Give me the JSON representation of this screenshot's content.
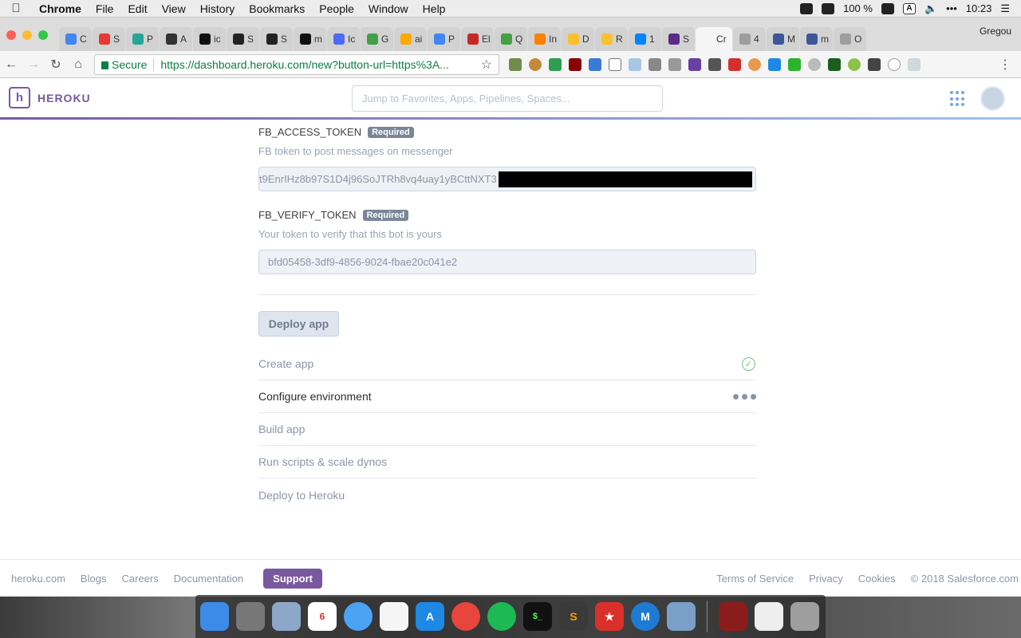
{
  "menubar": {
    "app_name": "Chrome",
    "items": [
      "File",
      "Edit",
      "View",
      "History",
      "Bookmarks",
      "People",
      "Window",
      "Help"
    ],
    "battery": "100 %",
    "input_source": "A",
    "clock": "10:23"
  },
  "tabs": [
    {
      "label": "C",
      "color": "#4285f4"
    },
    {
      "label": "S",
      "color": "#e53935"
    },
    {
      "label": "P",
      "color": "#26a69a"
    },
    {
      "label": "A",
      "color": "#333333"
    },
    {
      "label": "ic",
      "color": "#111111"
    },
    {
      "label": "S",
      "color": "#222222"
    },
    {
      "label": "S",
      "color": "#222222"
    },
    {
      "label": "m",
      "color": "#111111"
    },
    {
      "label": "Ic",
      "color": "#4e6cf0"
    },
    {
      "label": "G",
      "color": "#43a047"
    },
    {
      "label": "ai",
      "color": "#f9ab00"
    },
    {
      "label": "P",
      "color": "#4285f4"
    },
    {
      "label": "El",
      "color": "#c62828"
    },
    {
      "label": "Q",
      "color": "#43a047"
    },
    {
      "label": "In",
      "color": "#ff7f00"
    },
    {
      "label": "D",
      "color": "#fbc02d"
    },
    {
      "label": "R",
      "color": "#fbc02d"
    },
    {
      "label": "1",
      "color": "#0084ff"
    },
    {
      "label": "S",
      "color": "#5b2b8a"
    },
    {
      "label": "Cr",
      "color": "#f5f5f5",
      "active": true
    },
    {
      "label": "4",
      "color": "#9e9e9e"
    },
    {
      "label": "M",
      "color": "#3b5998"
    },
    {
      "label": "m",
      "color": "#3b5998"
    },
    {
      "label": "O",
      "color": "#9e9e9e"
    }
  ],
  "profile_name": "Gregou",
  "addressbar": {
    "secure_label": "Secure",
    "url": "https://dashboard.heroku.com/new?button-url=https%3A..."
  },
  "heroku": {
    "brand": "HEROKU",
    "search_placeholder": "Jump to Favorites, Apps, Pipelines, Spaces..."
  },
  "config_vars": [
    {
      "name": "FB_ACCESS_TOKEN",
      "badge": "Required",
      "description": "FB token to post messages on messenger",
      "value": "t9EnrIHz8b97S1D4j96SoJTRh8vq4uay1yBCttNXT3"
    },
    {
      "name": "FB_VERIFY_TOKEN",
      "badge": "Required",
      "description": "Your token to verify that this bot is yours",
      "value": "bfd05458-3df9-4856-9024-fbae20c041e2"
    }
  ],
  "deploy_button": "Deploy app",
  "steps": [
    {
      "label": "Create app",
      "status": "done"
    },
    {
      "label": "Configure environment",
      "status": "in-progress"
    },
    {
      "label": "Build app",
      "status": "pending"
    },
    {
      "label": "Run scripts & scale dynos",
      "status": "pending"
    },
    {
      "label": "Deploy to Heroku",
      "status": "pending"
    }
  ],
  "footer": {
    "left_links": [
      "heroku.com",
      "Blogs",
      "Careers",
      "Documentation"
    ],
    "support": "Support",
    "right_links": [
      "Terms of Service",
      "Privacy",
      "Cookies",
      "© 2018 Salesforce.com"
    ]
  },
  "colors": {
    "heroku_purple": "#79589f",
    "secure_green": "#0b8043",
    "done_green": "#74c080"
  }
}
